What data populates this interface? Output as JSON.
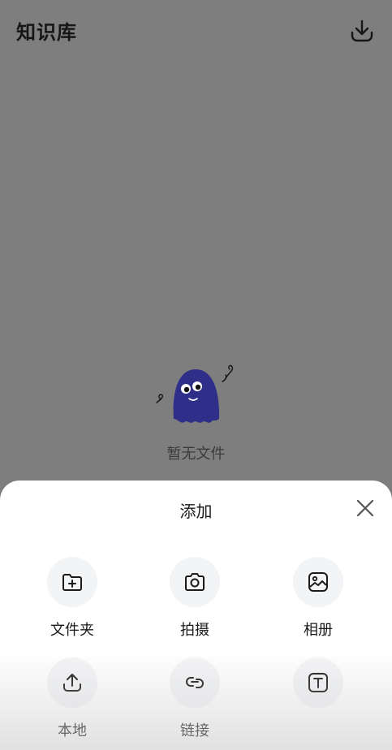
{
  "header": {
    "title": "知识库",
    "download_icon": "download-icon"
  },
  "empty_state": {
    "text": "暂无文件",
    "illustration": "ghost-mascot"
  },
  "sheet": {
    "title": "添加",
    "close_icon": "close-icon",
    "items": [
      {
        "label": "文件夹",
        "icon": "folder-add-icon"
      },
      {
        "label": "拍摄",
        "icon": "camera-icon"
      },
      {
        "label": "相册",
        "icon": "gallery-icon"
      },
      {
        "label": "本地",
        "icon": "upload-icon"
      },
      {
        "label": "链接",
        "icon": "link-icon"
      },
      {
        "label": "",
        "icon": "text-icon"
      }
    ]
  },
  "colors": {
    "overlay": "#7e7e7e",
    "sheet": "#ffffff",
    "icon_bg": "#f3f4f6",
    "mascot": "#2f2f8a"
  }
}
